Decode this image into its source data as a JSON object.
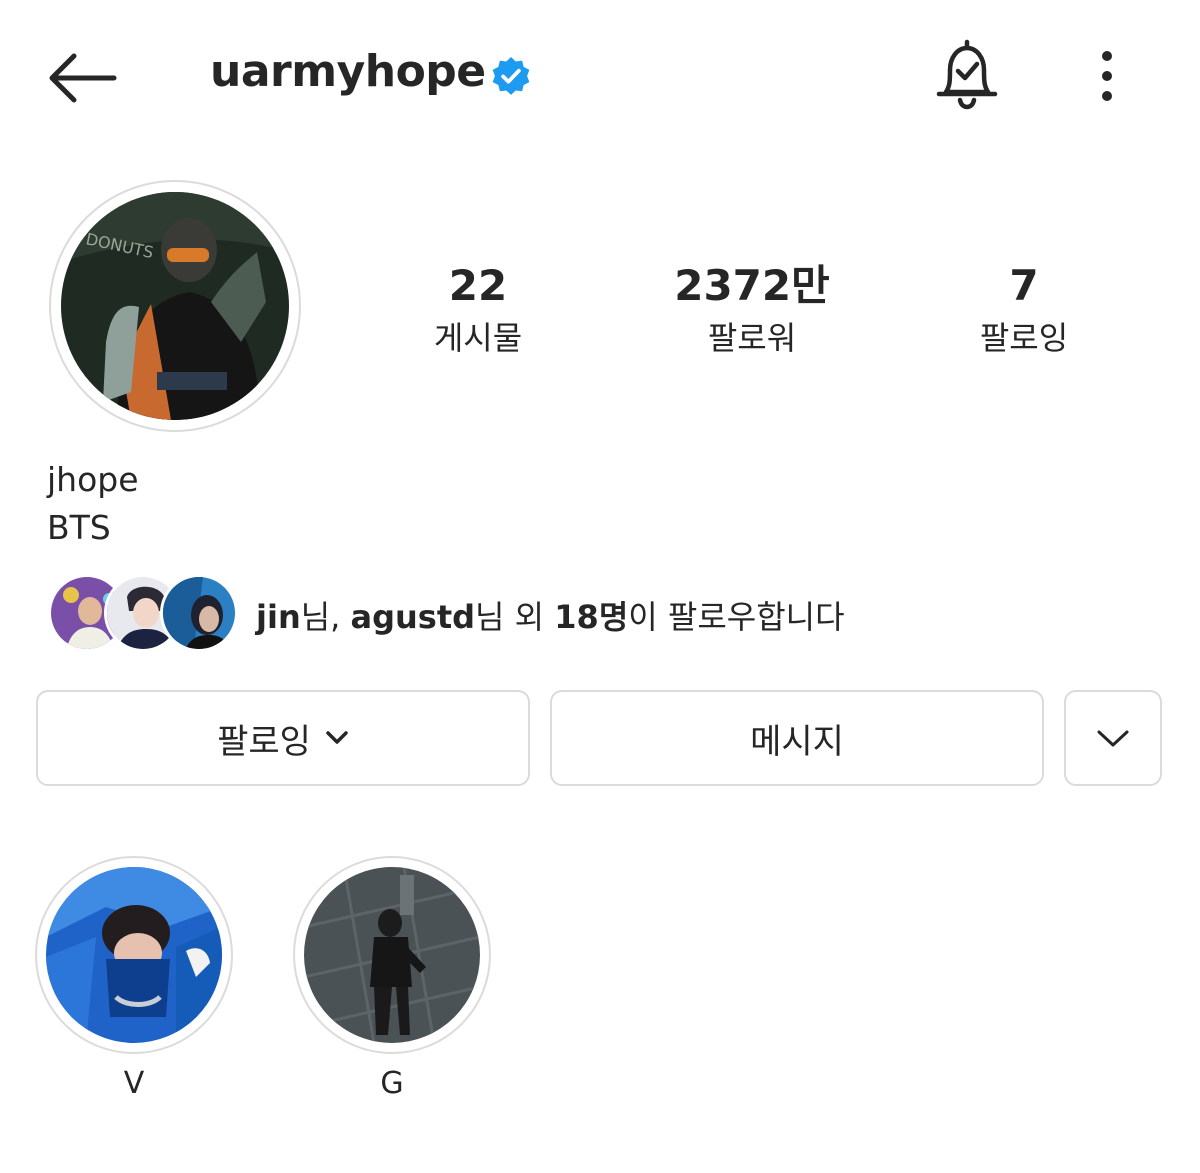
{
  "header": {
    "username": "uarmyhope",
    "icons": [
      "back-arrow-icon",
      "verified-badge-icon",
      "bell-check-icon",
      "more-vertical-icon"
    ]
  },
  "stats": {
    "posts": {
      "value": "22",
      "label": "게시물"
    },
    "followers": {
      "value": "2372만",
      "label": "팔로워"
    },
    "following": {
      "value": "7",
      "label": "팔로잉"
    }
  },
  "profile": {
    "full_name": "jhope",
    "bio": "BTS"
  },
  "mutual": {
    "name1": "jin",
    "suffix1": "님, ",
    "name2": "agustd",
    "suffix2": "님 외 ",
    "count": "18명",
    "suffix3": "이 팔로우합니다"
  },
  "buttons": {
    "following_label": "팔로잉",
    "message_label": "메시지"
  },
  "highlights": [
    {
      "label": "V"
    },
    {
      "label": "G"
    }
  ],
  "colors": {
    "verified": "#1d9bf0",
    "text": "#262626",
    "border": "#dbdbdb"
  }
}
